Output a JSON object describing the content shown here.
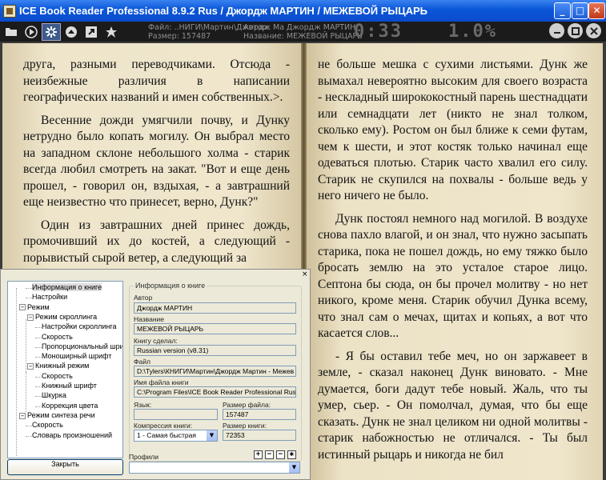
{
  "window": {
    "title": "ICE Book Reader Professional 8.9.2 Rus / Джордж МАРТИН / МЕЖЕВОЙ РЫЦАРЬ",
    "minimize": "_",
    "maximize": "□",
    "close": "✕"
  },
  "toolbar_icons": [
    "folder-icon",
    "play-icon",
    "settings-icon",
    "eject-icon",
    "pointer-icon",
    "star-icon"
  ],
  "info": {
    "file_label": "Файл:",
    "file_value": "..НИГИ\\Мартин\\Джордж Ма",
    "size_label": "Размер:",
    "size_value": "157487",
    "author_label": "Автор:",
    "author_value": "Джордж МАРТИН",
    "title_label": "Название:",
    "title_value": "МЕЖЕВОЙ РЫЦАРЬ"
  },
  "clock": "0:33",
  "percent": "1.0%",
  "left_page": [
    {
      "text": "друга, разными переводчиками. Отсюда - неизбежные различия в написании географических названий и имен собственных.>.",
      "indent": false
    },
    {
      "text": "Весенние дожди умягчили почву, и Дунку нетрудно было копать могилу. Он выбрал место на западном склоне небольшого холма - старик всегда любил смотреть на закат. \"Вот и еще день прошел, - говорил он, вздыхая, - а завтрашний еще неизвестно что принесет, верно, Дунк?\"",
      "indent": true
    },
    {
      "text": "Один из завтрашних дней принес дождь, промочивший их до костей, а следующий - порывистый сырой ветер, а следующий за",
      "indent": true
    }
  ],
  "right_page": [
    {
      "text": "не больше мешка с сухими листьями. Дунк же вымахал невероятно высоким для своего возраста - нескладный ширококостный парень шестнадцати или семнадцати лет (никто не знал толком, сколько ему). Ростом он был ближе к семи футам, чем к шести, и этот костяк только начинал еще одеваться плотью. Старик часто хвалил его силу. Старик не скупился на похвалы - больше ведь у него ничего не было.",
      "indent": false
    },
    {
      "text": "Дунк постоял немного над могилой. В воздухе снова пахло влагой, и он знал, что нужно засыпать старика, пока не пошел дождь, но ему тяжко было бросать землю на это усталое старое лицо. Септона бы сюда, он бы прочел молитву - но нет никого, кроме меня. Старик обучил Дунка всему, что знал сам о мечах, щитах и копьях, а вот что касается слов...",
      "indent": true
    },
    {
      "text": "- Я бы оставил тебе меч, но он заржавеет в земле, - сказал наконец Дунк виновато. - Мне думается, боги дадут тебе новый. Жаль, что ты умер, сьер. - Он помолчал, думая, что бы еще сказать. Дунк не знал целиком ни одной молитвы - старик набожностью не отличался. - Ты был истинный рыцарь и никогда не бил",
      "indent": true
    }
  ],
  "dialog": {
    "close_x": "×",
    "tree": [
      {
        "label": "Информация о книге",
        "level": 1,
        "sel": true,
        "pm": ""
      },
      {
        "label": "Настройки",
        "level": 1,
        "pm": ""
      },
      {
        "label": "Режим",
        "level": 0,
        "pm": "−"
      },
      {
        "label": "Режим скроллинга",
        "level": 1,
        "pm": "−"
      },
      {
        "label": "Настройки скроллинга",
        "level": 2,
        "pm": ""
      },
      {
        "label": "Скорость",
        "level": 2,
        "pm": ""
      },
      {
        "label": "Пропорциональный шрифт",
        "level": 2,
        "pm": ""
      },
      {
        "label": "Моноширный шрифт",
        "level": 2,
        "pm": ""
      },
      {
        "label": "Книжный режим",
        "level": 1,
        "pm": "−"
      },
      {
        "label": "Скорость",
        "level": 2,
        "pm": ""
      },
      {
        "label": "Книжный шрифт",
        "level": 2,
        "pm": ""
      },
      {
        "label": "Шкурка",
        "level": 2,
        "pm": ""
      },
      {
        "label": "Коррекция цвета",
        "level": 2,
        "pm": ""
      },
      {
        "label": "Режим синтеза речи",
        "level": 0,
        "pm": "−"
      },
      {
        "label": "Скорость",
        "level": 1,
        "pm": ""
      },
      {
        "label": "Словарь произношений",
        "level": 1,
        "pm": ""
      }
    ],
    "close_button": "Закрыть",
    "group_title": "Информация о книге",
    "fields": {
      "author_label": "Автор",
      "author": "Джордж МАРТИН",
      "title_label": "Название",
      "title": "МЕЖЕВОЙ РЫЦАРЬ",
      "made_label": "Книгу сделал:",
      "made": "Russian version (v8.31)",
      "file_label": "Файл",
      "file": "D:\\Tylers\\КНИГИ\\Мартин\\Джордж Мартин - Межев",
      "bookfile_label": "Имя файла книги",
      "bookfile": "C:\\Program Files\\ICE Book Reader Professional Russia",
      "lang_label": "Язык:",
      "lang": "",
      "fsize_label": "Размер файла:",
      "fsize": "157487",
      "comp_label": "Компрессия книги:",
      "comp": "1 - Самая быстрая",
      "bsize_label": "Размер книги:",
      "bsize": "72353"
    },
    "profiles_label": "Профили",
    "profile_btns": [
      "+",
      "−",
      "−",
      "✱"
    ]
  }
}
